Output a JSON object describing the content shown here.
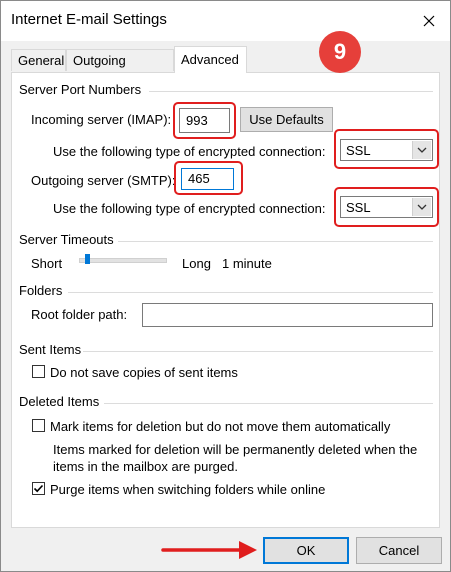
{
  "window": {
    "title": "Internet E-mail Settings",
    "close_icon": "close-icon"
  },
  "tabs": [
    {
      "label": "General",
      "active": false
    },
    {
      "label": "Outgoing Server",
      "active": false
    },
    {
      "label": "Advanced",
      "active": true
    }
  ],
  "step_badge": "9",
  "server_ports": {
    "group_label": "Server Port Numbers",
    "incoming_label": "Incoming server (IMAP):",
    "incoming_value": "993",
    "use_defaults_label": "Use Defaults",
    "incoming_encryption_label": "Use the following type of encrypted connection:",
    "incoming_encryption_value": "SSL",
    "outgoing_label": "Outgoing server (SMTP):",
    "outgoing_value": "465",
    "outgoing_encryption_label": "Use the following type of encrypted connection:",
    "outgoing_encryption_value": "SSL"
  },
  "timeouts": {
    "group_label": "Server Timeouts",
    "short_label": "Short",
    "long_label": "Long",
    "value_label": "1 minute"
  },
  "folders": {
    "group_label": "Folders",
    "root_label": "Root folder path:",
    "root_value": ""
  },
  "sent_items": {
    "group_label": "Sent Items",
    "no_copies_label": "Do not save copies of sent items",
    "no_copies_checked": false
  },
  "deleted_items": {
    "group_label": "Deleted Items",
    "mark_label": "Mark items for deletion but do not move them automatically",
    "mark_checked": false,
    "note_line1": "Items marked for deletion will be permanently deleted when the",
    "note_line2": "items in the mailbox are purged.",
    "purge_label": "Purge items when switching folders while online",
    "purge_checked": true
  },
  "footer": {
    "ok_label": "OK",
    "cancel_label": "Cancel"
  },
  "colors": {
    "highlight": "#e01e1e",
    "badge": "#e63f3a",
    "accent": "#0078d7"
  }
}
